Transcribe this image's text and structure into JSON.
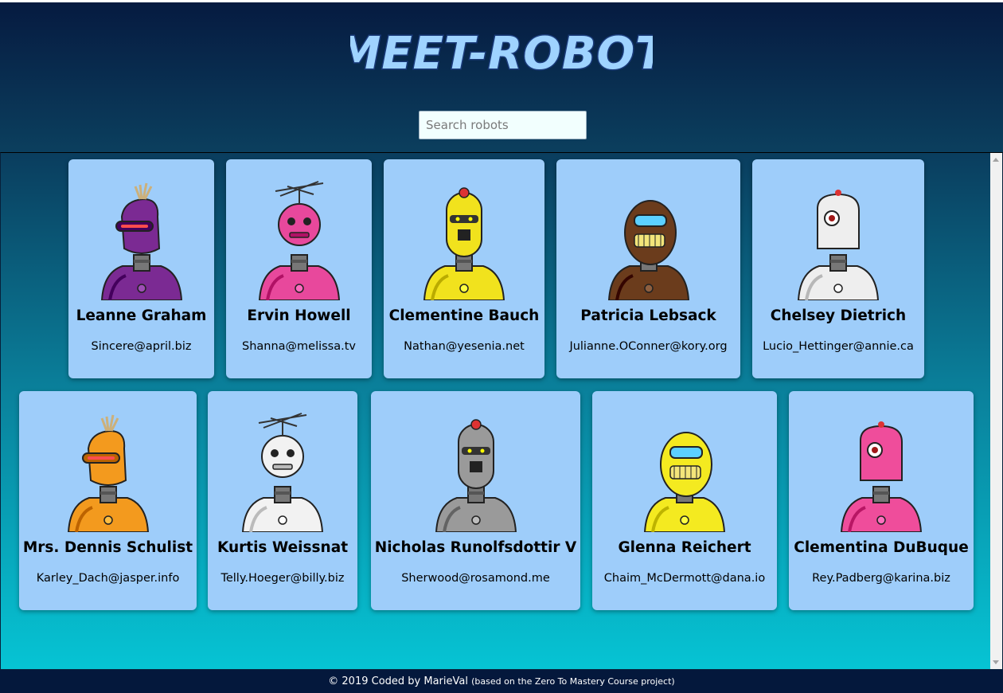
{
  "app": {
    "title": "MEET-ROBOT",
    "title_fill": "#9fd3ff",
    "title_stroke": "#1a3b7a"
  },
  "search": {
    "placeholder": "Search robots",
    "value": ""
  },
  "robots": [
    {
      "name": "Leanne Graham",
      "email": "Sincere@april.biz",
      "icon": "purple-robot-icon",
      "color": "#7b2a93"
    },
    {
      "name": "Ervin Howell",
      "email": "Shanna@melissa.tv",
      "icon": "pink-robot-icon",
      "color": "#e8489c"
    },
    {
      "name": "Clementine Bauch",
      "email": "Nathan@yesenia.net",
      "icon": "yellow-robot-icon",
      "color": "#f1e21d"
    },
    {
      "name": "Patricia Lebsack",
      "email": "Julianne.OConner@kory.org",
      "icon": "brown-robot-icon",
      "color": "#6b3c1c"
    },
    {
      "name": "Chelsey Dietrich",
      "email": "Lucio_Hettinger@annie.ca",
      "icon": "white-robot-icon",
      "color": "#eeeeee"
    },
    {
      "name": "Mrs. Dennis Schulist",
      "email": "Karley_Dach@jasper.info",
      "icon": "orange-robot-icon",
      "color": "#f39a1e"
    },
    {
      "name": "Kurtis Weissnat",
      "email": "Telly.Hoeger@billy.biz",
      "icon": "white-robot-icon",
      "color": "#f2f2f2"
    },
    {
      "name": "Nicholas Runolfsdottir V",
      "email": "Sherwood@rosamond.me",
      "icon": "gray-robot-icon",
      "color": "#9a9a9a"
    },
    {
      "name": "Glenna Reichert",
      "email": "Chaim_McDermott@dana.io",
      "icon": "yellow-robot-icon",
      "color": "#f4ea20"
    },
    {
      "name": "Clementina DuBuque",
      "email": "Rey.Padberg@karina.biz",
      "icon": "pink-robot-icon",
      "color": "#ef4d9b"
    }
  ],
  "footer": {
    "text": "© 2019 Coded by MarieVal",
    "note": "(based on the Zero To Mastery Course project)"
  }
}
